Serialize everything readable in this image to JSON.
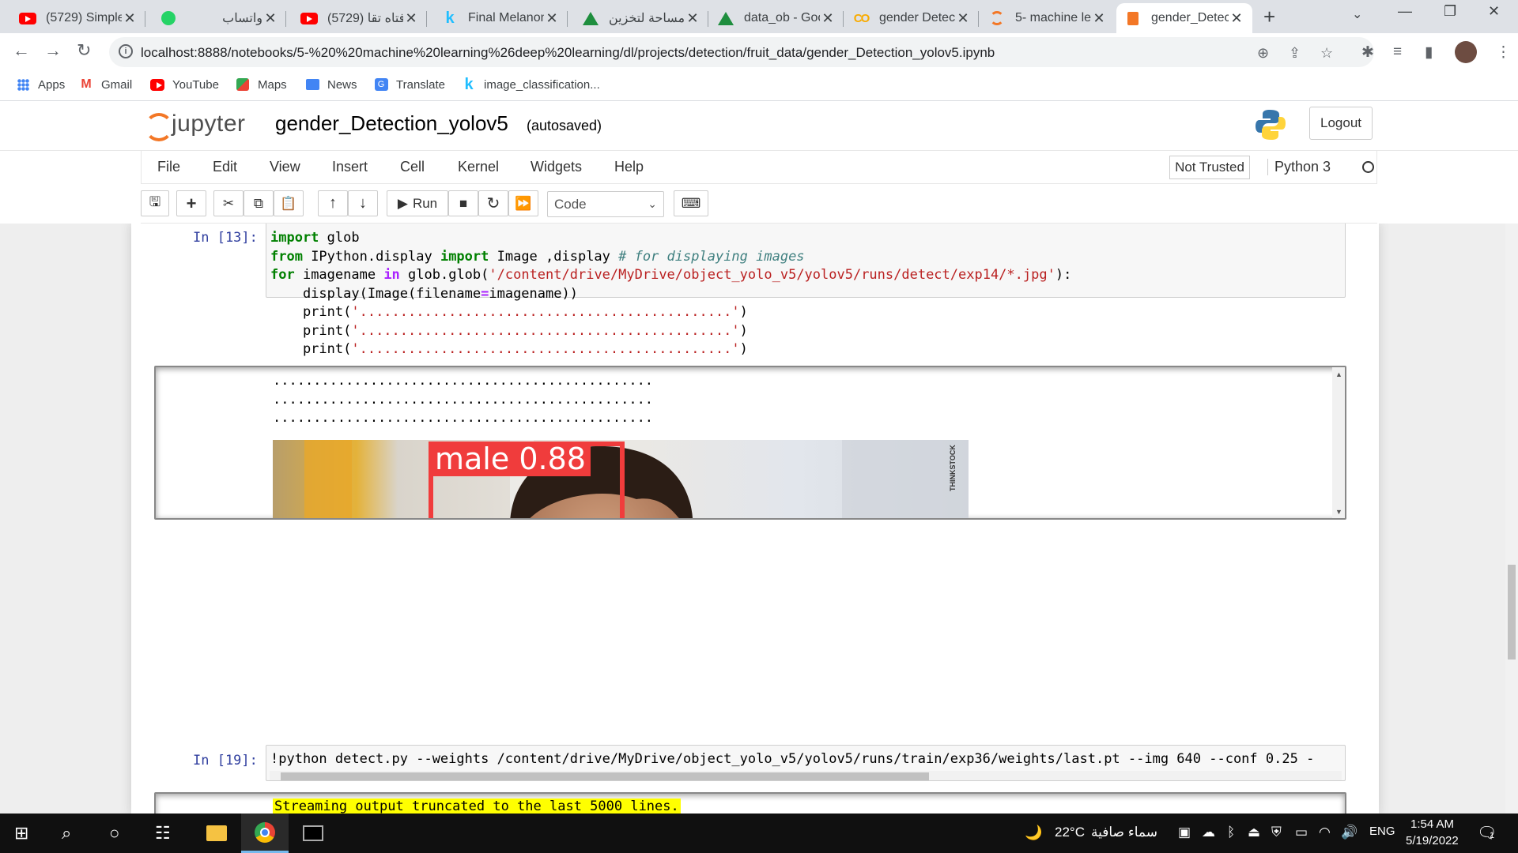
{
  "browser": {
    "tabs": [
      {
        "title": "(5729) Simple",
        "icon": "youtube-icon"
      },
      {
        "title": "واتساب",
        "icon": "whatsapp-icon"
      },
      {
        "title": "(5729) فتاه تقا",
        "icon": "youtube-icon"
      },
      {
        "title": "Final Melanom",
        "icon": "kaggle-icon"
      },
      {
        "title": "مساحة لتخزين",
        "icon": "google-drive-icon"
      },
      {
        "title": "data_ob - Goo",
        "icon": "google-drive-icon"
      },
      {
        "title": "gender Detect",
        "icon": "colab-icon"
      },
      {
        "title": "5- machine le",
        "icon": "jupyter-icon"
      },
      {
        "title": "gender_Detec",
        "icon": "jupyter-notebook-icon",
        "active": true
      }
    ],
    "url": "localhost:8888/notebooks/5-%20%20machine%20learning%26deep%20learning/dl/projects/detection/fruit_data/gender_Detection_yolov5.ipynb",
    "bookmarks": [
      {
        "label": "Apps",
        "icon": "apps-grid-icon"
      },
      {
        "label": "Gmail",
        "icon": "gmail-icon"
      },
      {
        "label": "YouTube",
        "icon": "youtube-icon"
      },
      {
        "label": "Maps",
        "icon": "maps-icon"
      },
      {
        "label": "News",
        "icon": "news-icon"
      },
      {
        "label": "Translate",
        "icon": "translate-icon"
      },
      {
        "label": "image_classification...",
        "icon": "kaggle-icon"
      }
    ]
  },
  "jupyter": {
    "logo_text": "jupyter",
    "notebook_title": "gender_Detection_yolov5",
    "autosave_status": "(autosaved)",
    "logout_label": "Logout",
    "menu": [
      "File",
      "Edit",
      "View",
      "Insert",
      "Cell",
      "Kernel",
      "Widgets",
      "Help"
    ],
    "trust_status": "Not Trusted",
    "kernel_name": "Python 3",
    "toolbar": {
      "run_label": "Run",
      "cell_type": "Code"
    }
  },
  "cells": {
    "cell1": {
      "prompt": "In [13]:"
    },
    "output1": {
      "dots": "...............................................",
      "detection_label": "male 0.88",
      "watermark": "THINKSTOCK"
    },
    "cell2": {
      "prompt": "In [19]:",
      "code": "!python detect.py --weights /content/drive/MyDrive/object_yolo_v5/yolov5/runs/train/exp36/weights/last.pt --img 640 --conf 0.25 -"
    },
    "output2": {
      "banner": "Streaming output truncated to the last 5000 lines."
    }
  },
  "taskbar": {
    "weather_temp": "22°C",
    "weather_text": "سماء صافية",
    "language": "ENG",
    "time": "1:54 AM",
    "date": "5/19/2022",
    "notification_count": "1"
  },
  "colors": {
    "jupyter_orange": "#f37726",
    "prompt_blue": "#303f9f",
    "detection_box": "#f03c3c",
    "keyword_green": "#008000",
    "string_red": "#ba2121"
  }
}
